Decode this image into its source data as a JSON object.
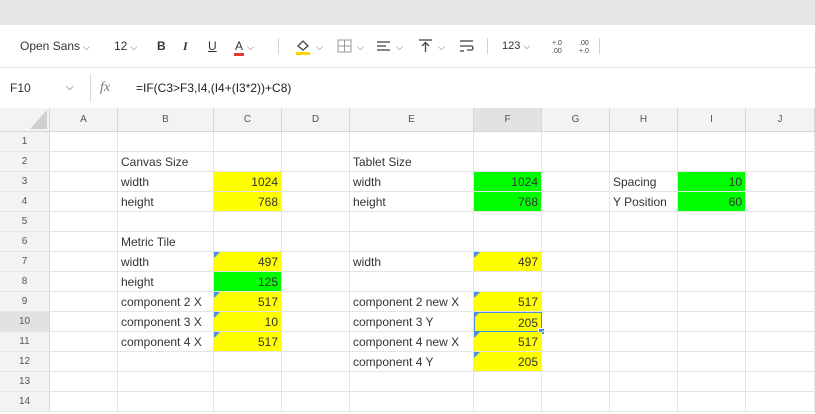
{
  "toolbar": {
    "font_family": "Open Sans",
    "font_size": "12",
    "bold": "B",
    "italic": "I",
    "underline": "U",
    "text_color": "A",
    "number_format": "123",
    "decimal_increase": "+.0\n.00",
    "decimal_decrease": ".00\n+.0",
    "text_color_underline": "#e53935",
    "fill_color_underline": "#ffd600"
  },
  "formula_bar": {
    "cell_ref": "F10",
    "fx": "fx",
    "formula": "=IF(C3>F3,I4,(I4+(I3*2))+C8)"
  },
  "columns": [
    "A",
    "B",
    "C",
    "D",
    "E",
    "F",
    "G",
    "H",
    "I",
    "J"
  ],
  "rows": [
    "1",
    "2",
    "3",
    "4",
    "5",
    "6",
    "7",
    "8",
    "9",
    "10",
    "11",
    "12",
    "13",
    "14"
  ],
  "selected": {
    "column": "F",
    "row": "10"
  },
  "colors": {
    "yellow": "#ffff00",
    "green": "#00ff00",
    "selection": "#4a90d9"
  },
  "cells": {
    "B2": "Canvas Size",
    "E2": "Tablet Size",
    "B3": "width",
    "C3": "1024",
    "E3": "width",
    "F3": "1024",
    "H3": "Spacing",
    "I3": "10",
    "B4": "height",
    "C4": "768",
    "E4": "height",
    "F4": "768",
    "H4": "Y Position",
    "I4": "60",
    "B6": "Metric Tile",
    "B7": "width",
    "C7": "497",
    "E7": "width",
    "F7": "497",
    "B8": "height",
    "C8": "125",
    "B9": "component 2 X",
    "C9": "517",
    "E9": "component 2 new X",
    "F9": "517",
    "B10": "component 3 X",
    "C10": "10",
    "E10": "component 3 Y",
    "F10": "205",
    "B11": "component 4 X",
    "C11": "517",
    "E11": "component 4 new X",
    "F11": "517",
    "E12": "component 4 Y",
    "F12": "205"
  }
}
